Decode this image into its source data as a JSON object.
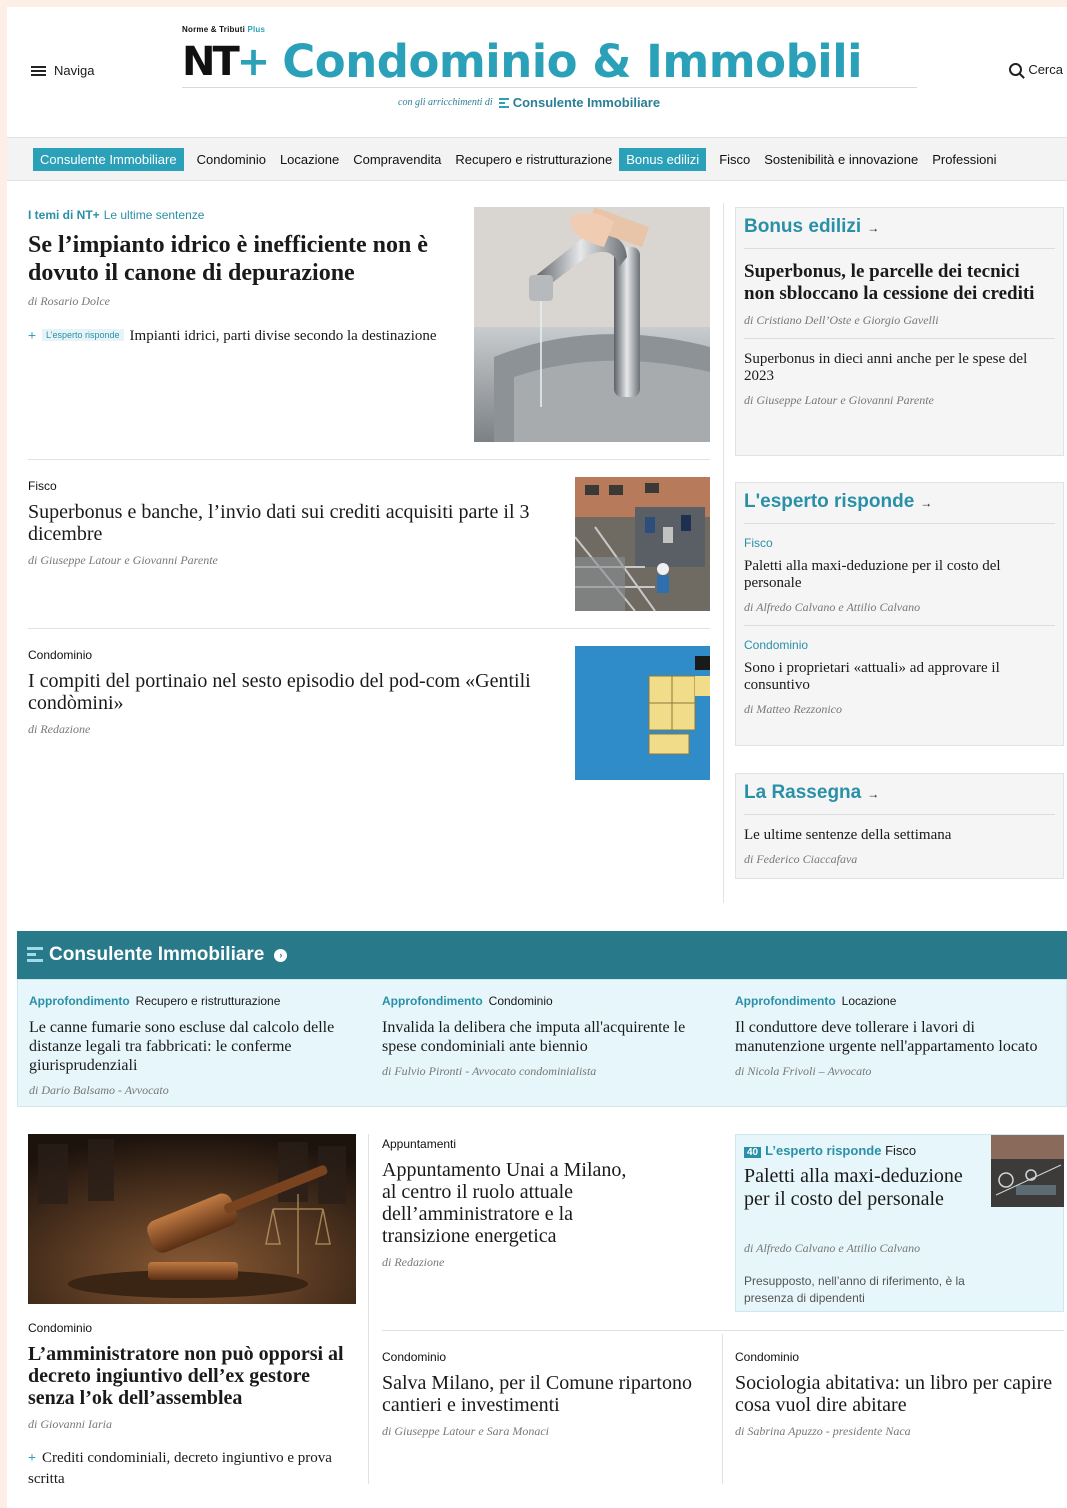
{
  "header": {
    "menu_label": "Naviga",
    "logo_super": "Norme & Tributi",
    "logo_super_plus": "Plus",
    "logo_nt": "NT",
    "logo_plus": "+",
    "logo_title": "Condominio & Immobili",
    "logo_sub": "con gli arricchimenti di",
    "logo_sub_brand": "Consulente Immobiliare",
    "search_label": "Cerca"
  },
  "nav": {
    "items": [
      {
        "label": "Consulente Immobiliare",
        "highlight": true
      },
      {
        "label": "Condominio",
        "highlight": false
      },
      {
        "label": "Locazione",
        "highlight": false
      },
      {
        "label": "Compravendita",
        "highlight": false
      },
      {
        "label": "Recupero e ristrutturazione",
        "highlight": false
      },
      {
        "label": "Bonus edilizi",
        "highlight": true
      },
      {
        "label": "Fisco",
        "highlight": false
      },
      {
        "label": "Sostenibilità e innovazione",
        "highlight": false
      },
      {
        "label": "Professioni",
        "highlight": false
      }
    ]
  },
  "lead": {
    "kicker_bold": "I temi di NT+",
    "kicker_tag": "Le ultime sentenze",
    "title": "Se l’impianto idrico è inefficiente non è dovuto il canone di depurazione",
    "byline": "di Rosario Dolce",
    "related_plus": "+",
    "related_tag": "L’esperto risponde",
    "related_title": "Impianti idrici, parti divise secondo la destinazione"
  },
  "articles": [
    {
      "kicker": "Fisco",
      "title": "Superbonus e banche, l’invio dati sui crediti acquisiti parte il 3 dicembre",
      "byline": "di Giuseppe Latour e Giovanni Parente"
    },
    {
      "kicker": "Condominio",
      "title": "I compiti del portinaio nel sesto episodio del pod-com «Gentili condòmini»",
      "byline": "di Redazione"
    }
  ],
  "bonus_box": {
    "heading": "Bonus edilizi",
    "arrow": "→",
    "items": [
      {
        "title": "Superbonus, le parcelle dei tecnici non sbloccano la cessione dei crediti",
        "byline": "di Cristiano Dell’Oste e Giorgio Gavelli"
      },
      {
        "title": "Superbonus in dieci anni anche per le spese del 2023",
        "byline": "di Giuseppe Latour e Giovanni Parente"
      }
    ]
  },
  "esperto_box": {
    "heading": "L'esperto risponde",
    "arrow": "→",
    "items": [
      {
        "kicker": "Fisco",
        "title": "Paletti alla maxi-deduzione per il costo del personale",
        "byline": "di Alfredo Calvano e Attilio Calvano"
      },
      {
        "kicker": "Condominio",
        "title": "Sono i proprietari «attuali» ad approvare il consuntivo",
        "byline": "di Matteo Rezzonico"
      }
    ]
  },
  "rassegna_box": {
    "heading": "La Rassegna",
    "arrow": "→",
    "items": [
      {
        "title": "Le ultime sentenze della settimana",
        "byline": "di Federico Ciaccafava"
      }
    ]
  },
  "consulente": {
    "heading": "Consulente Immobiliare",
    "circle": "›",
    "columns": [
      {
        "kicker_bold": "Approfondimento",
        "kicker": "Recupero e ristrutturazione",
        "title": "Le canne fumarie sono escluse dal calcolo delle distanze legali tra fabbricati: le conferme giurisprudenziali",
        "byline": "di Dario Balsamo - Avvocato"
      },
      {
        "kicker_bold": "Approfondimento",
        "kicker": "Condominio",
        "title": "Invalida la delibera che imputa all'acquirente le spese condominiali ante biennio",
        "byline": "di Fulvio Pironti - Avvocato condominialista"
      },
      {
        "kicker_bold": "Approfondimento",
        "kicker": "Locazione",
        "title": "Il conduttore deve tollerare i lavori di manutenzione urgente nell'appartamento locato",
        "byline": "di Nicola Frivoli – Avvocato"
      }
    ]
  },
  "bottom": {
    "left": {
      "kicker": "Condominio",
      "title": "L’amministratore non può opporsi al decreto ingiuntivo dell’ex gestore senza l’ok dell’assemblea",
      "byline": "di Giovanni Iaria",
      "related_plus": "+",
      "related_title": "Crediti condominiali, decreto ingiuntivo e prova scritta"
    },
    "middle_top": {
      "kicker": "Appuntamenti",
      "title": "Appuntamento Unai a Milano, al centro il ruolo attuale dell’amministratore e la transizione energetica",
      "byline": "di Redazione"
    },
    "esperto": {
      "badge": "40",
      "tag": "L’esperto risponde",
      "kicker": "Fisco",
      "title": "Paletti alla maxi-deduzione per il costo del personale",
      "byline": "di Alfredo Calvano e Attilio Calvano",
      "summary": "Presupposto, nell’anno di riferimento, è la presenza di dipendenti"
    },
    "middle_bottom": {
      "kicker": "Condominio",
      "title": "Salva Milano, per il Comune ripartono cantieri e investimenti",
      "byline": "di Giuseppe Latour e Sara Monaci"
    },
    "right_bottom": {
      "kicker": "Condominio",
      "title": "Sociologia abitativa: un libro per capire cosa vuol dire abitare",
      "byline": "di Sabrina Apuzzo - presidente Naca"
    }
  },
  "colors": {
    "accent": "#2ba1b9",
    "band": "#287a8a",
    "band_light": "#e6f6fa",
    "page_bg": "#fdeee6"
  }
}
